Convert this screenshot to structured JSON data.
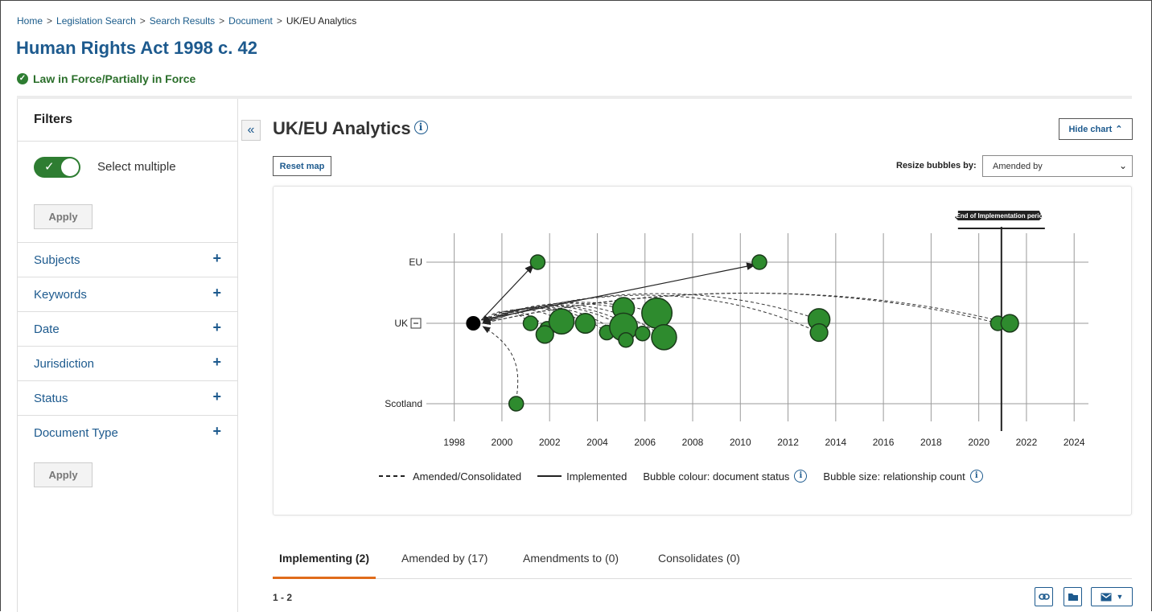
{
  "breadcrumb": [
    "Home",
    "Legislation Search",
    "Search Results",
    "Document",
    "UK/EU Analytics"
  ],
  "page_title": "Human Rights Act 1998 c. 42",
  "status": "Law in Force/Partially in Force",
  "sidebar": {
    "title": "Filters",
    "toggle_label": "Select multiple",
    "apply": "Apply",
    "facets": [
      "Subjects",
      "Keywords",
      "Date",
      "Jurisdiction",
      "Status",
      "Document Type"
    ]
  },
  "main": {
    "title": "UK/EU Analytics",
    "hide_chart": "Hide chart",
    "reset_map": "Reset map",
    "resize_label": "Resize bubbles by:",
    "resize_value": "Amended by"
  },
  "legend": {
    "amended": "Amended/Consolidated",
    "implemented": "Implemented",
    "colour": "Bubble colour: document status",
    "size": "Bubble size: relationship count"
  },
  "tabs": [
    "Implementing (2)",
    "Amended by (17)",
    "Amendments to (0)",
    "Consolidates (0)"
  ],
  "results_count": "1 - 2",
  "colors": {
    "accent": "#1d5a8e",
    "bubble": "#2e8b2e",
    "tab_active": "#e06c1b"
  },
  "chart_data": {
    "type": "scatter",
    "x_ticks": [
      "1998",
      "2000",
      "2002",
      "2004",
      "2006",
      "2008",
      "2010",
      "2012",
      "2014",
      "2016",
      "2018",
      "2020",
      "2022",
      "2024"
    ],
    "y_categories": [
      "EU",
      "UK",
      "Scotland"
    ],
    "xlim": [
      1997,
      2024.6
    ],
    "marker_label": "End of Implementation period",
    "marker_x": 2020.95,
    "source": {
      "x": 1998.8,
      "y": "UK"
    },
    "points": [
      {
        "x": 2001.5,
        "y": "EU",
        "size": 1,
        "link": "implemented"
      },
      {
        "x": 2010.8,
        "y": "EU",
        "size": 1,
        "link": "implemented"
      },
      {
        "x": 2000.6,
        "y": "Scotland",
        "size": 1,
        "link": "amended"
      },
      {
        "x": 2001.2,
        "y": "UK",
        "offset": 0,
        "size": 1,
        "link": "amended"
      },
      {
        "x": 2001.9,
        "y": "UK",
        "offset": 0.3,
        "size": 1,
        "link": "amended"
      },
      {
        "x": 2001.8,
        "y": "UK",
        "offset": 0.6,
        "size": 2,
        "link": "amended"
      },
      {
        "x": 2002.5,
        "y": "UK",
        "offset": -0.1,
        "size": 6,
        "link": "amended"
      },
      {
        "x": 2003.5,
        "y": "UK",
        "offset": 0,
        "size": 3,
        "link": "amended"
      },
      {
        "x": 2004.4,
        "y": "UK",
        "offset": 0.5,
        "size": 1,
        "link": "amended"
      },
      {
        "x": 2005.1,
        "y": "UK",
        "offset": -0.8,
        "size": 4,
        "link": "amended"
      },
      {
        "x": 2005.1,
        "y": "UK",
        "offset": 0.2,
        "size": 8,
        "link": "amended"
      },
      {
        "x": 2005.2,
        "y": "UK",
        "offset": 0.9,
        "size": 1,
        "link": "amended"
      },
      {
        "x": 2005.9,
        "y": "UK",
        "offset": 0.55,
        "size": 1,
        "link": "amended"
      },
      {
        "x": 2006.5,
        "y": "UK",
        "offset": -0.55,
        "size": 10,
        "link": "amended"
      },
      {
        "x": 2006.8,
        "y": "UK",
        "offset": 0.75,
        "size": 6,
        "link": "amended"
      },
      {
        "x": 2013.3,
        "y": "UK",
        "offset": -0.2,
        "size": 4,
        "link": "amended"
      },
      {
        "x": 2013.3,
        "y": "UK",
        "offset": 0.5,
        "size": 2,
        "link": "amended"
      },
      {
        "x": 2020.8,
        "y": "UK",
        "offset": 0,
        "size": 1,
        "link": "amended"
      },
      {
        "x": 2021.3,
        "y": "UK",
        "offset": 0,
        "size": 2,
        "link": "amended"
      }
    ]
  }
}
